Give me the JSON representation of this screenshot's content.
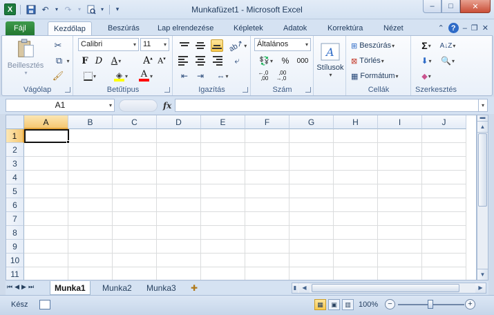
{
  "window": {
    "title": "Munkafüzet1  -  Microsoft Excel",
    "app_icon": "X",
    "buttons": {
      "minimize": "–",
      "maximize": "□",
      "close": "✕"
    }
  },
  "ribbon_tabs": {
    "file": "Fájl",
    "items": [
      "Kezdőlap",
      "Beszúrás",
      "Lap elrendezése",
      "Képletek",
      "Adatok",
      "Korrektúra",
      "Nézet"
    ],
    "active": "Kezdőlap"
  },
  "ribbon": {
    "clipboard": {
      "label": "Vágólap",
      "paste": "Beillesztés"
    },
    "font": {
      "label": "Betűtípus",
      "font_name": "Calibri",
      "font_size": "11"
    },
    "alignment": {
      "label": "Igazítás"
    },
    "number": {
      "label": "Szám",
      "format": "Általános",
      "percent": "%",
      "thousands": "000"
    },
    "styles": {
      "label": "Stílusok"
    },
    "cells": {
      "label": "Cellák",
      "insert": "Beszúrás",
      "delete": "Törlés",
      "format": "Formátum"
    },
    "editing": {
      "label": "Szerkesztés",
      "sum_symbol": "Σ"
    }
  },
  "formula_bar": {
    "name_box": "A1",
    "fx": "fx",
    "value": ""
  },
  "grid": {
    "columns": [
      "A",
      "B",
      "C",
      "D",
      "E",
      "F",
      "G",
      "H",
      "I",
      "J"
    ],
    "rows": [
      "1",
      "2",
      "3",
      "4",
      "5",
      "6",
      "7",
      "8",
      "9",
      "10",
      "11"
    ],
    "selected_cell": "A1"
  },
  "sheets": {
    "tabs": [
      "Munka1",
      "Munka2",
      "Munka3"
    ],
    "active": "Munka1"
  },
  "status": {
    "ready": "Kész",
    "zoom": "100%"
  },
  "colors": {
    "file_tab": "#2a8a3a",
    "selection_header": "#f5c772",
    "accent_blue": "#2e6bc7"
  }
}
